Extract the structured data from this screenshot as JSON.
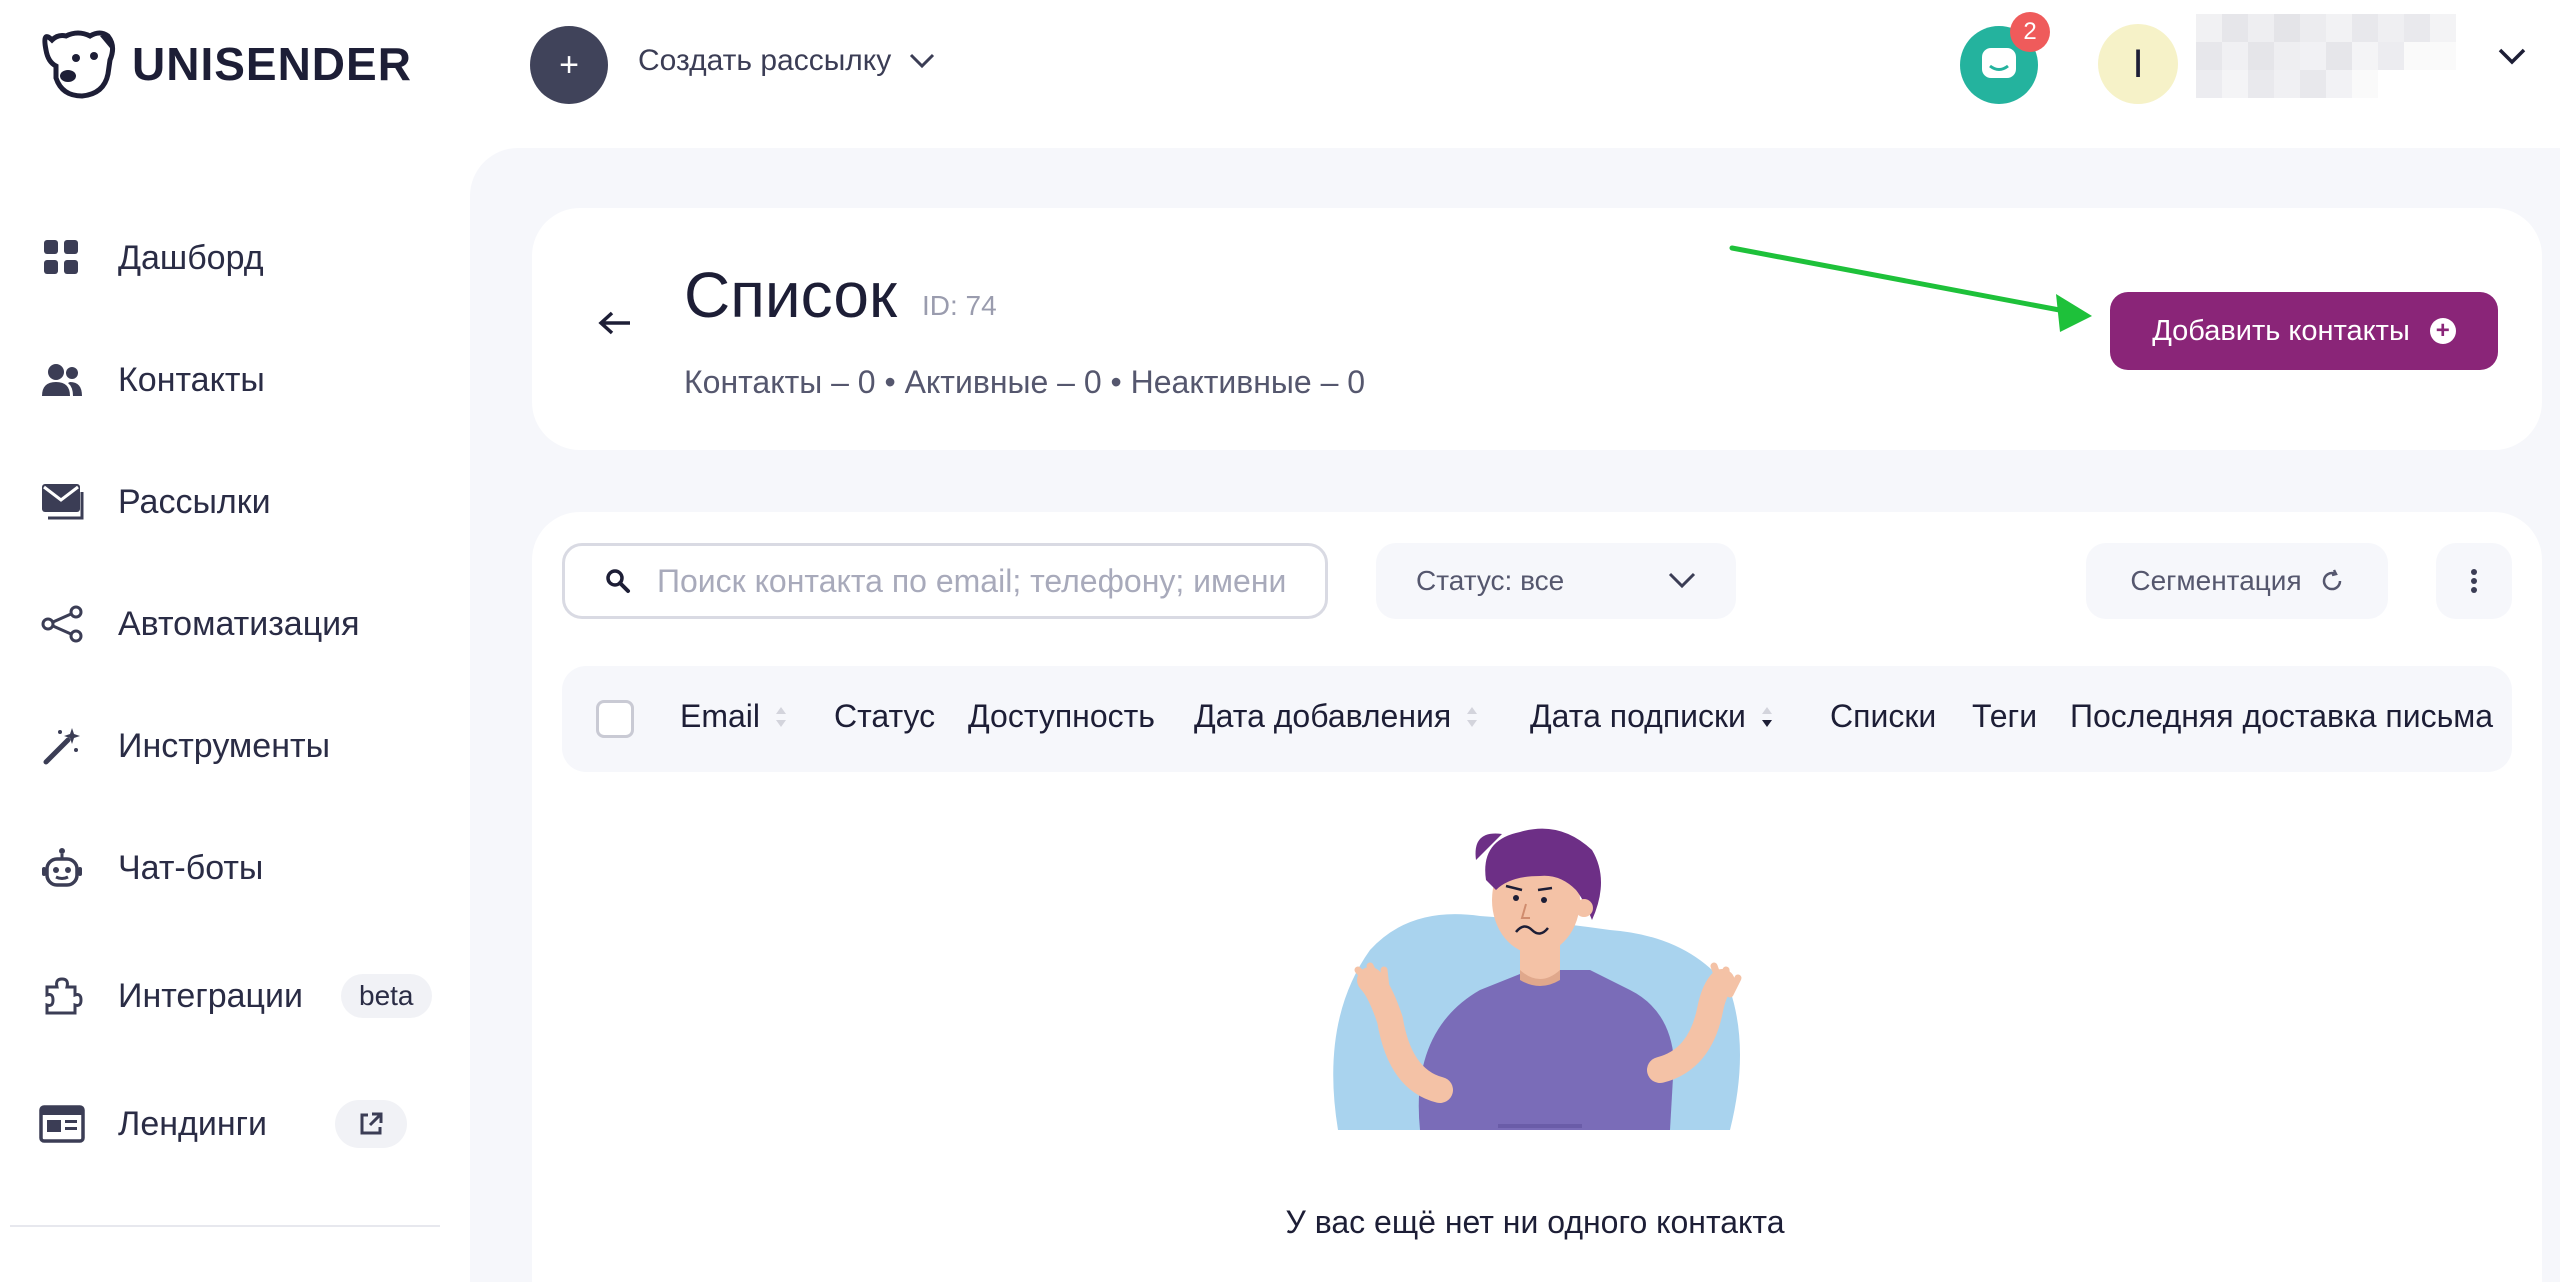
{
  "header": {
    "logo_text": "UNISENDER",
    "create_label": "Создать рассылку",
    "chat_badge": "2",
    "avatar_letter": "I"
  },
  "sidebar": {
    "items": [
      {
        "label": "Дашборд",
        "icon": "grid-icon"
      },
      {
        "label": "Контакты",
        "icon": "people-icon"
      },
      {
        "label": "Рассылки",
        "icon": "mail-icon"
      },
      {
        "label": "Автоматизация",
        "icon": "share-nodes-icon"
      },
      {
        "label": "Инструменты",
        "icon": "magic-wand-icon"
      },
      {
        "label": "Чат-боты",
        "icon": "robot-icon"
      },
      {
        "label": "Интеграции",
        "icon": "puzzle-icon",
        "badge": "beta"
      },
      {
        "label": "Лендинги",
        "icon": "landing-icon",
        "badge_icon": "external-link-icon"
      }
    ]
  },
  "page": {
    "title": "Список",
    "id_label": "ID: 74",
    "stats": "Контакты – 0 • Активные – 0 • Неактивные – 0",
    "add_button": "Добавить контакты"
  },
  "toolbar": {
    "search_placeholder": "Поиск контакта по email; телефону; имени",
    "status_filter": "Статус: все",
    "segmentation": "Сегментация"
  },
  "table": {
    "columns": [
      "Email",
      "Статус",
      "Доступность",
      "Дата добавления",
      "Дата подписки",
      "Списки",
      "Теги",
      "Последняя доставка письма"
    ]
  },
  "empty_state": {
    "message": "У вас ещё нет ни одного контакта"
  },
  "colors": {
    "primary": "#8a2578",
    "chat": "#24b39e",
    "badge": "#ef5b5b",
    "arrow": "#1ec13a"
  }
}
